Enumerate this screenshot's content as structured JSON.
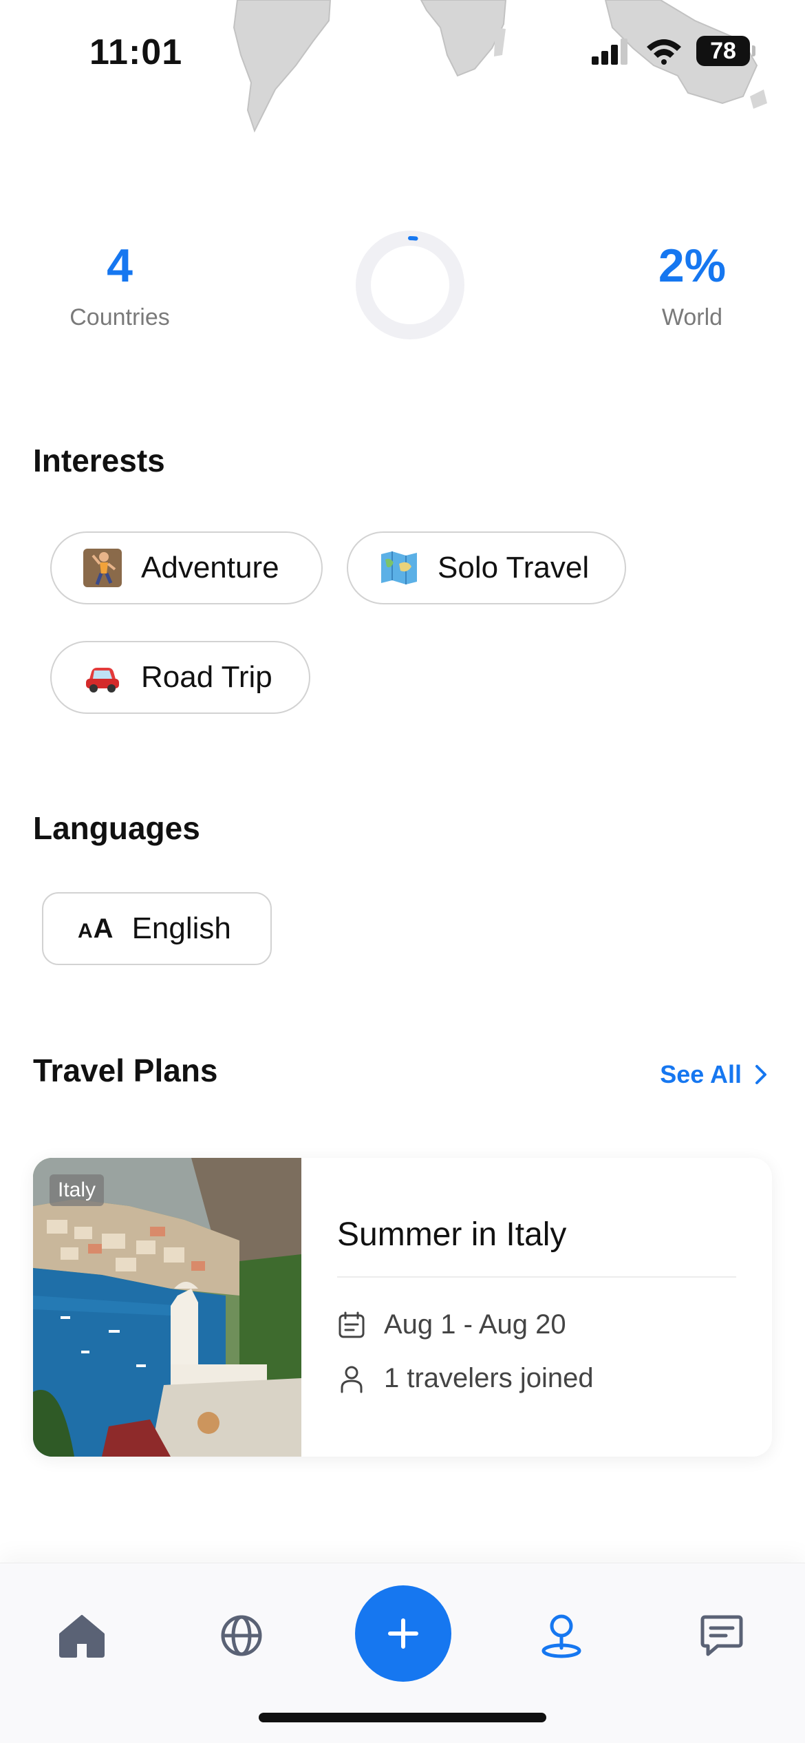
{
  "status_bar": {
    "time": "11:01",
    "battery": "78"
  },
  "stats": {
    "countries": {
      "value": "4",
      "label": "Countries"
    },
    "world": {
      "value": "2%",
      "label": "World"
    },
    "progress_fraction": 0.02
  },
  "interests": {
    "title": "Interests",
    "items": [
      {
        "label": "Adventure",
        "icon": "climber-emoji"
      },
      {
        "label": "Solo Travel",
        "icon": "map-emoji"
      },
      {
        "label": "Road Trip",
        "icon": "car-emoji"
      }
    ]
  },
  "languages": {
    "title": "Languages",
    "items": [
      {
        "label": "English",
        "icon": "text-size-icon",
        "icon_text_small": "A",
        "icon_text_large": "A"
      }
    ]
  },
  "travel_plans": {
    "title": "Travel Plans",
    "see_all": "See All",
    "cards": [
      {
        "tag": "Italy",
        "title": "Summer in Italy",
        "dates": "Aug 1 - Aug 20",
        "travelers": "1 travelers joined"
      }
    ]
  },
  "nav": {
    "items": [
      "home-icon",
      "globe-icon",
      "add-icon",
      "location-pin-icon",
      "chat-icon"
    ],
    "active": "location-pin-icon"
  },
  "colors": {
    "accent": "#1677f0",
    "icon_gray": "#5a6275"
  }
}
